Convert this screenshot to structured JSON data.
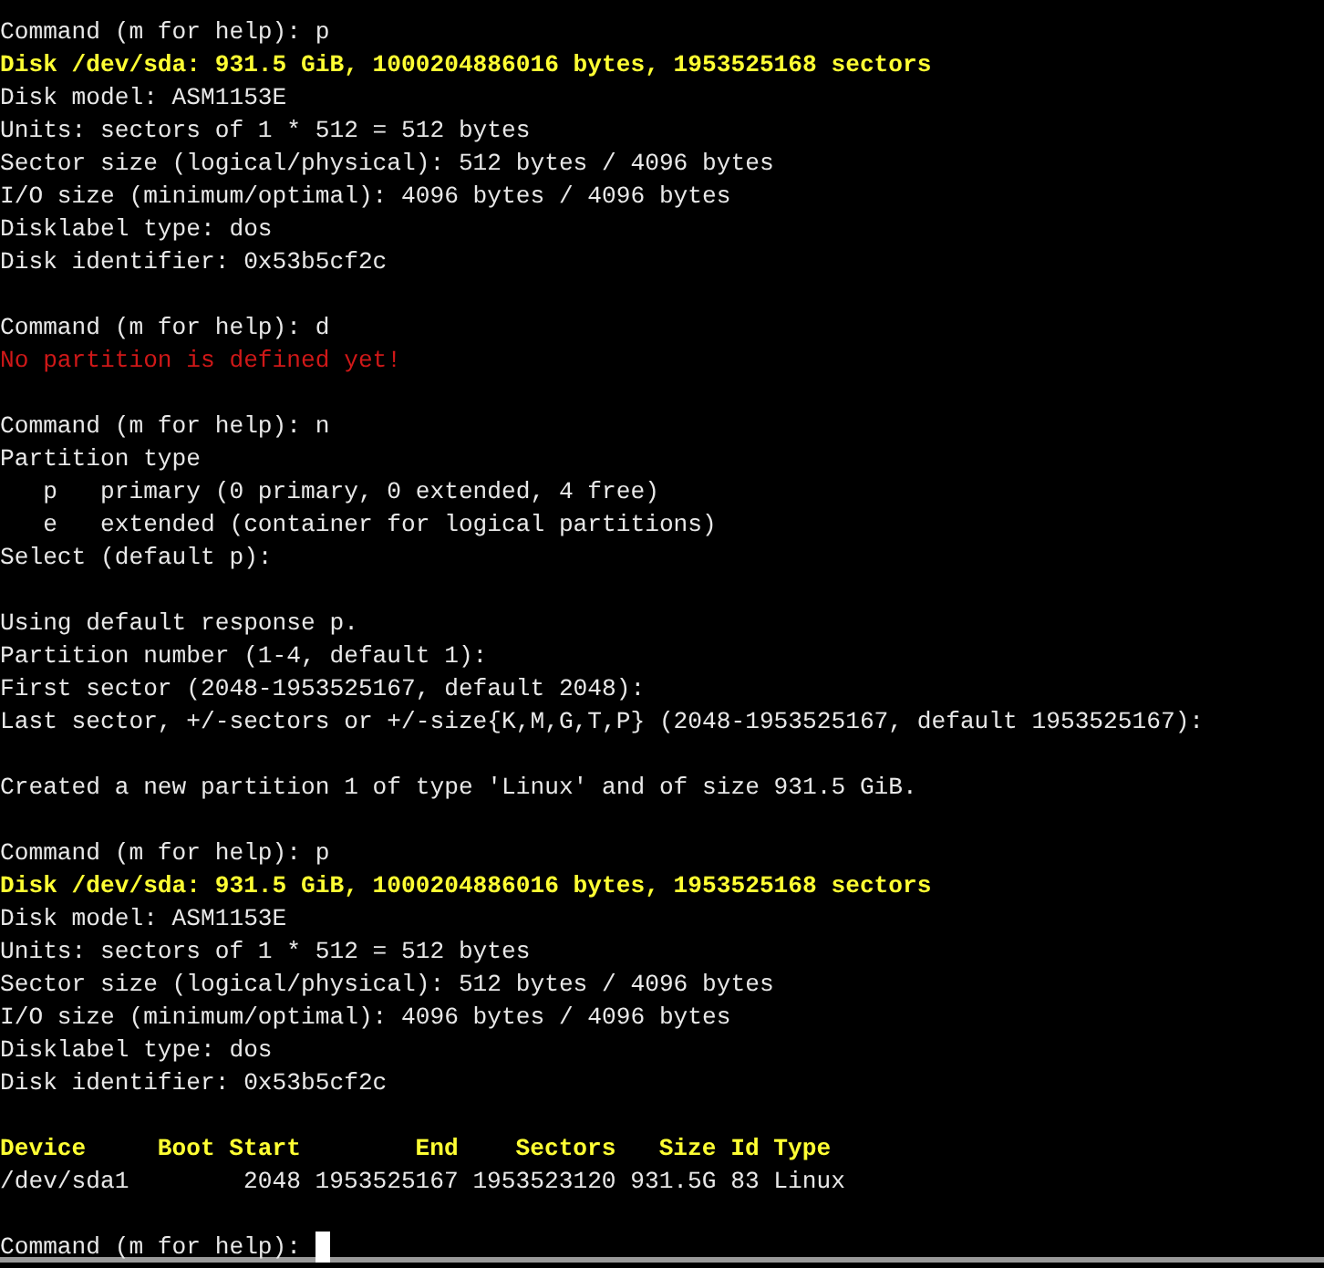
{
  "terminal": {
    "lines": [
      {
        "kind": "normal",
        "text": "Command (m for help): p"
      },
      {
        "kind": "highlight",
        "text": "Disk /dev/sda: 931.5 GiB, 1000204886016 bytes, 1953525168 sectors"
      },
      {
        "kind": "normal",
        "text": "Disk model: ASM1153E"
      },
      {
        "kind": "normal",
        "text": "Units: sectors of 1 * 512 = 512 bytes"
      },
      {
        "kind": "normal",
        "text": "Sector size (logical/physical): 512 bytes / 4096 bytes"
      },
      {
        "kind": "normal",
        "text": "I/O size (minimum/optimal): 4096 bytes / 4096 bytes"
      },
      {
        "kind": "normal",
        "text": "Disklabel type: dos"
      },
      {
        "kind": "normal",
        "text": "Disk identifier: 0x53b5cf2c"
      },
      {
        "kind": "blank"
      },
      {
        "kind": "normal",
        "text": "Command (m for help): d"
      },
      {
        "kind": "error",
        "text": "No partition is defined yet!"
      },
      {
        "kind": "blank"
      },
      {
        "kind": "normal",
        "text": "Command (m for help): n"
      },
      {
        "kind": "normal",
        "text": "Partition type"
      },
      {
        "kind": "normal",
        "text": "   p   primary (0 primary, 0 extended, 4 free)"
      },
      {
        "kind": "normal",
        "text": "   e   extended (container for logical partitions)"
      },
      {
        "kind": "normal",
        "text": "Select (default p):"
      },
      {
        "kind": "blank"
      },
      {
        "kind": "normal",
        "text": "Using default response p."
      },
      {
        "kind": "normal",
        "text": "Partition number (1-4, default 1):"
      },
      {
        "kind": "normal",
        "text": "First sector (2048-1953525167, default 2048):"
      },
      {
        "kind": "normal",
        "text": "Last sector, +/-sectors or +/-size{K,M,G,T,P} (2048-1953525167, default 1953525167):"
      },
      {
        "kind": "blank"
      },
      {
        "kind": "normal",
        "text": "Created a new partition 1 of type 'Linux' and of size 931.5 GiB."
      },
      {
        "kind": "blank"
      },
      {
        "kind": "normal",
        "text": "Command (m for help): p"
      },
      {
        "kind": "highlight",
        "text": "Disk /dev/sda: 931.5 GiB, 1000204886016 bytes, 1953525168 sectors"
      },
      {
        "kind": "normal",
        "text": "Disk model: ASM1153E"
      },
      {
        "kind": "normal",
        "text": "Units: sectors of 1 * 512 = 512 bytes"
      },
      {
        "kind": "normal",
        "text": "Sector size (logical/physical): 512 bytes / 4096 bytes"
      },
      {
        "kind": "normal",
        "text": "I/O size (minimum/optimal): 4096 bytes / 4096 bytes"
      },
      {
        "kind": "normal",
        "text": "Disklabel type: dos"
      },
      {
        "kind": "normal",
        "text": "Disk identifier: 0x53b5cf2c"
      },
      {
        "kind": "blank"
      }
    ],
    "partition_table": {
      "columns": [
        "Device",
        "Boot",
        "Start",
        "End",
        "Sectors",
        "Size",
        "Id",
        "Type"
      ],
      "rows": [
        [
          "/dev/sda1",
          "",
          "2048",
          "1953525167",
          "1953523120",
          "931.5G",
          "83",
          "Linux"
        ]
      ]
    },
    "after_table": [
      {
        "kind": "blank"
      },
      {
        "kind": "normal",
        "text": "Command (m for help): ",
        "cursor": true
      }
    ]
  }
}
